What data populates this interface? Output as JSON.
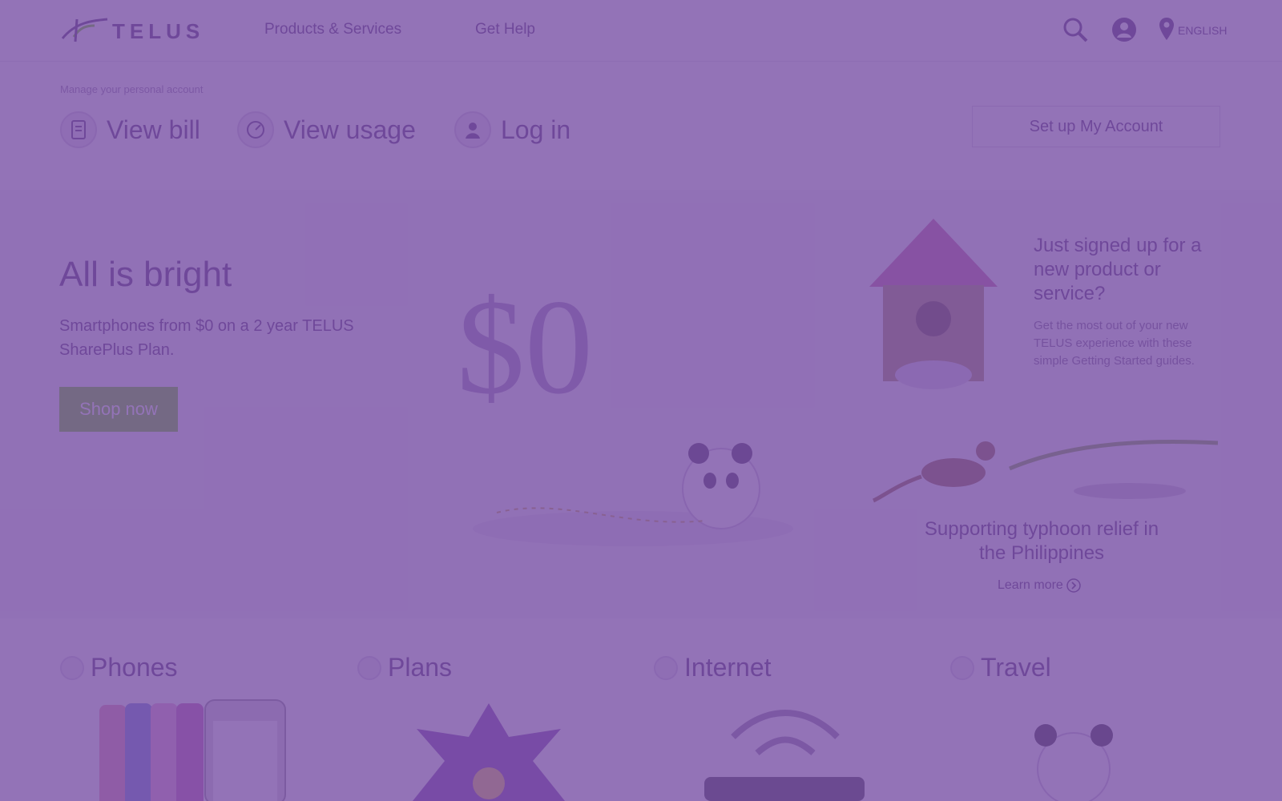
{
  "header": {
    "logo_text": "TELUS",
    "nav": [
      "Products & Services",
      "Get Help"
    ],
    "region": "ENGLISH"
  },
  "account": {
    "label": "Manage your personal account",
    "quick_links": [
      "View bill",
      "View usage",
      "Log in"
    ],
    "setup_button": "Set up My Account"
  },
  "hero": {
    "title": "All is bright",
    "subtitle": "Smartphones from $0 on a 2 year TELUS SharePlus Plan.",
    "cta": "Shop now",
    "big_price": "$0"
  },
  "promos": {
    "getting_started": {
      "title": "Just signed up for a new product or service?",
      "body": "Get the most out of your new TELUS experience with these simple Getting Started guides."
    },
    "typhoon": {
      "title": "Supporting typhoon relief in the Philippines",
      "link": "Learn more"
    }
  },
  "categories": [
    "Phones",
    "Plans",
    "Internet",
    "Travel"
  ],
  "colors": {
    "brand_purple": "#4b286d",
    "accent_green": "#66cc00",
    "overlay": "#7850a5"
  }
}
